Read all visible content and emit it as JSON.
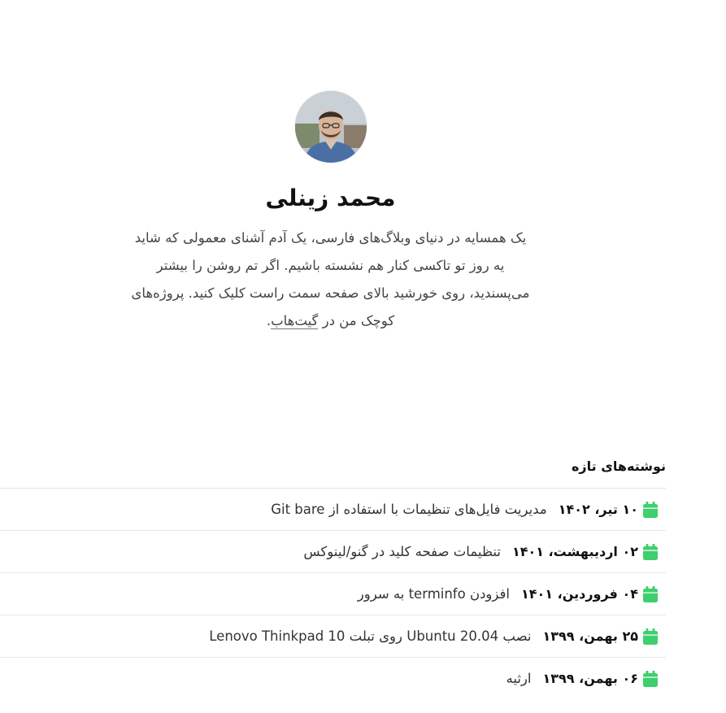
{
  "profile": {
    "name": "محمد زینلی",
    "bio_text": "یک همسایه در دنیای وبلاگ‌های فارسی، یک آدم آشنای معمولی که شاید یه روز تو تاکسی کنار هم نشسته باشیم. اگر تم روشن را بیشتر می‌پسندید، روی خورشید بالای صفحه سمت راست کلیک کنید. پروژه‌های کوچک من در ",
    "bio_link": "گیت‌هاب",
    "bio_end": "."
  },
  "recent": {
    "title": "نوشته‌های تازه",
    "icon": "calendar-icon",
    "icon_color": "#3ecf6e",
    "posts": [
      {
        "date": "۱۰ تیر، ۱۴۰۲",
        "title": "مدیریت فایل‌های تنظیمات با استفاده از Git bare"
      },
      {
        "date": "۰۲ اردیبهشت، ۱۴۰۱",
        "title": "تنظیمات صفحه کلید در گنو/لینوکس"
      },
      {
        "date": "۰۴ فروردین، ۱۴۰۱",
        "title": "افزودن terminfo به سرور"
      },
      {
        "date": "۲۵ بهمن، ۱۳۹۹",
        "title": "نصب Ubuntu 20.04 روی تبلت Lenovo Thinkpad 10"
      },
      {
        "date": "۰۶ بهمن، ۱۳۹۹",
        "title": "ارثیه"
      }
    ]
  }
}
